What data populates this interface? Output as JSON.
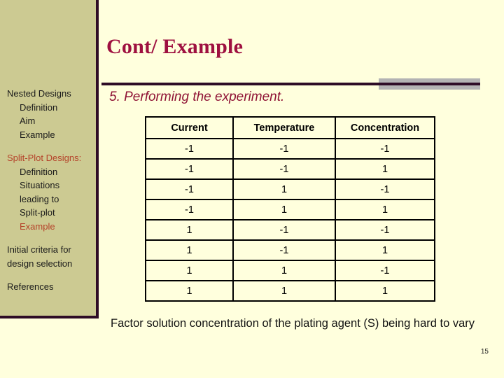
{
  "slide": {
    "title": "Cont/ Example",
    "subtitle": "5. Performing the experiment.",
    "footer_note": "Factor solution concentration of the plating agent (S) being hard to vary",
    "page_number": "15",
    "colors": {
      "background": "#ffffdd",
      "sidebar": "#ccca92",
      "border": "#2e0c26",
      "title": "#9e1040",
      "subtitle": "#8f1335",
      "accent_text": "#b5432a",
      "rule_accent": "#b3b3b3",
      "table_border": "#000000"
    }
  },
  "sidebar": {
    "groups": [
      {
        "items": [
          {
            "label": "Nested Designs",
            "indent": false,
            "accent": false
          },
          {
            "label": "Definition",
            "indent": true,
            "accent": false
          },
          {
            "label": "Aim",
            "indent": true,
            "accent": false
          },
          {
            "label": "Example",
            "indent": true,
            "accent": false
          }
        ]
      },
      {
        "items": [
          {
            "label": "Split-Plot Designs:",
            "indent": false,
            "accent": true
          },
          {
            "label": "Definition",
            "indent": true,
            "accent": false
          },
          {
            "label": "Situations",
            "indent": true,
            "accent": false
          },
          {
            "label": "leading to",
            "indent": true,
            "accent": false
          },
          {
            "label": "Split-plot",
            "indent": true,
            "accent": false
          },
          {
            "label": "Example",
            "indent": true,
            "accent": true
          }
        ]
      },
      {
        "items": [
          {
            "label": "Initial criteria for",
            "indent": false,
            "accent": false
          },
          {
            "label": "design selection",
            "indent": false,
            "accent": false
          }
        ]
      },
      {
        "items": [
          {
            "label": "References",
            "indent": false,
            "accent": false
          }
        ]
      }
    ]
  },
  "chart_data": {
    "type": "table",
    "title": "5. Performing the experiment.",
    "columns": [
      "Current",
      "Temperature",
      "Concentration"
    ],
    "rows": [
      [
        "-1",
        "-1",
        "-1"
      ],
      [
        "-1",
        "-1",
        "1"
      ],
      [
        "-1",
        "1",
        "-1"
      ],
      [
        "-1",
        "1",
        "1"
      ],
      [
        "1",
        "-1",
        "-1"
      ],
      [
        "1",
        "-1",
        "1"
      ],
      [
        "1",
        "1",
        "-1"
      ],
      [
        "1",
        "1",
        "1"
      ]
    ]
  }
}
